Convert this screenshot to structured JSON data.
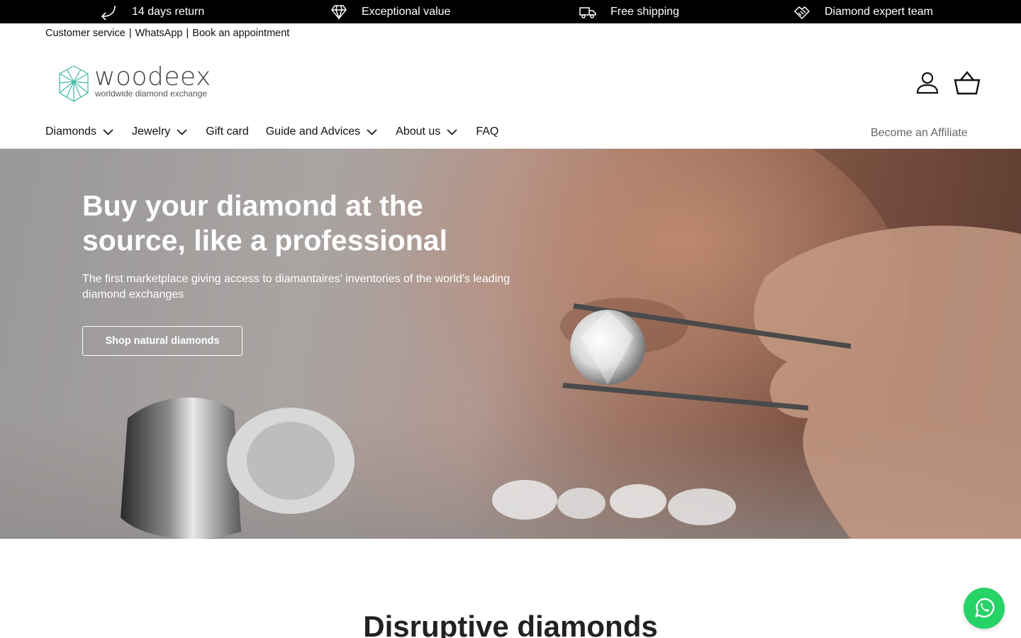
{
  "topbar": {
    "usps": [
      {
        "label": "14 days return",
        "icon": "return-arrow-icon"
      },
      {
        "label": "Exceptional value",
        "icon": "diamond-icon"
      },
      {
        "label": "Free shipping",
        "icon": "truck-icon"
      },
      {
        "label": "Diamond expert team",
        "icon": "handshake-icon"
      }
    ]
  },
  "utility": {
    "links": [
      "Customer service",
      "WhatsApp",
      "Book an appointment"
    ],
    "separator": "|"
  },
  "header": {
    "logo_word": "woodeex",
    "logo_tagline": "worldwide diamond exchange",
    "account_icon": "account-icon",
    "cart_icon": "basket-icon"
  },
  "nav": {
    "items": [
      {
        "label": "Diamonds",
        "dropdown": true
      },
      {
        "label": "Jewelry",
        "dropdown": true
      },
      {
        "label": "Gift card",
        "dropdown": false
      },
      {
        "label": "Guide and Advices",
        "dropdown": true
      },
      {
        "label": "About us",
        "dropdown": true
      },
      {
        "label": "FAQ",
        "dropdown": false
      }
    ],
    "affiliate": "Become an Affiliate"
  },
  "hero": {
    "title": "Buy your diamond at the source, like a professional",
    "subtitle": "The first marketplace giving access to diamantaires' inventories of the world’s leading diamond exchanges",
    "cta": "Shop natural diamonds"
  },
  "section": {
    "title": "Disruptive diamonds"
  },
  "colors": {
    "topbar_bg": "#000000",
    "whatsapp": "#25d366",
    "logo_accent": "#3fb7a3"
  }
}
